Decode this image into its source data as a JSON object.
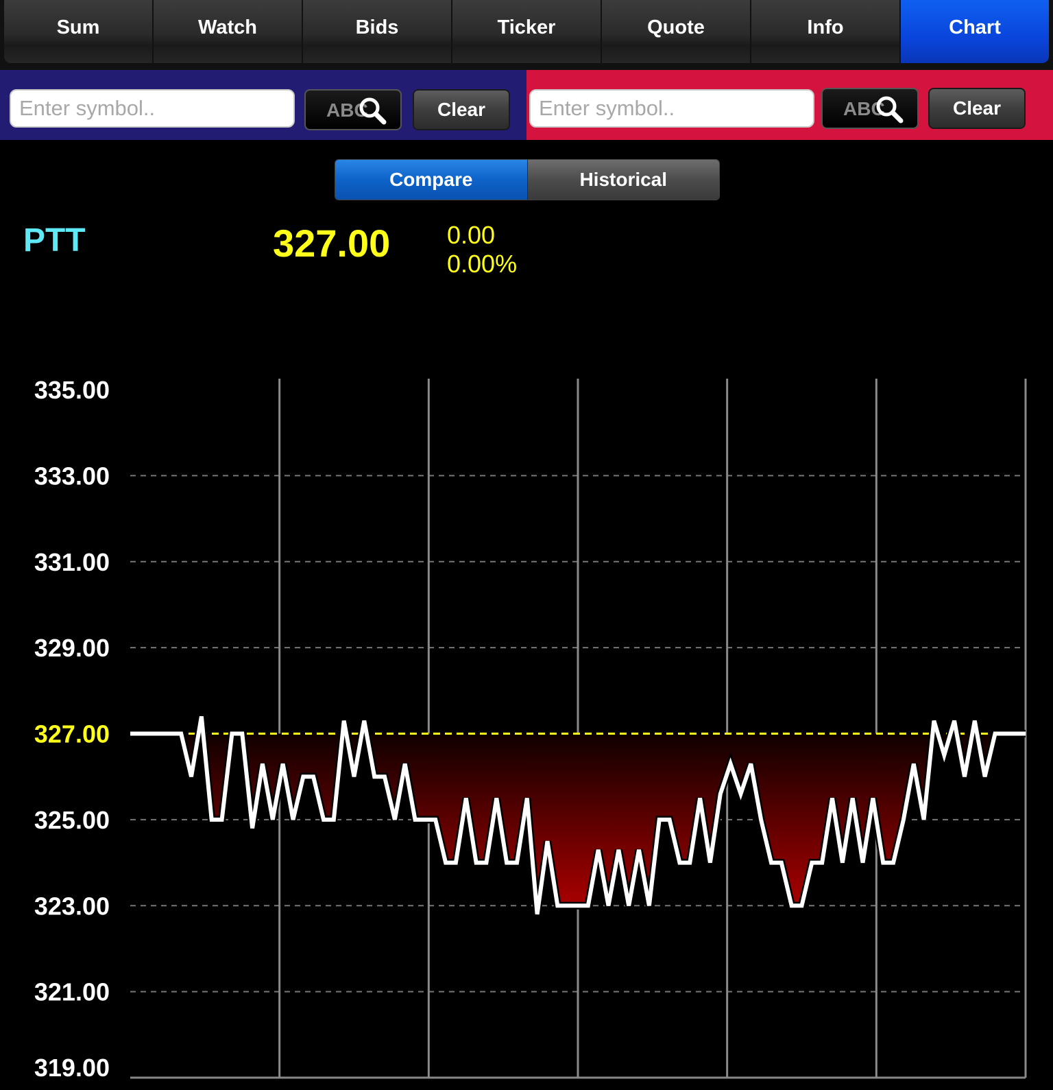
{
  "tabs": [
    "Sum",
    "Watch",
    "Bids",
    "Ticker",
    "Quote",
    "Info",
    "Chart"
  ],
  "active_tab": "Chart",
  "left_bar": {
    "placeholder": "Enter symbol..",
    "abc_label": "ABC",
    "clear_label": "Clear"
  },
  "right_bar": {
    "placeholder": "Enter symbol..",
    "abc_label": "ABC",
    "clear_label": "Clear"
  },
  "segment": {
    "compare": "Compare",
    "historical": "Historical",
    "selected": "Compare"
  },
  "quote": {
    "symbol": "PTT",
    "last": "327.00",
    "change": "0.00",
    "change_pct": "0.00%"
  },
  "colors": {
    "symbol": "#5fe8f5",
    "price": "#ffff1a",
    "left_bar": "#221d73",
    "right_bar": "#d4143e",
    "active_tab": "#0a45db",
    "line": "#ffffff",
    "fill": "#a50000",
    "reference": "#ffff1a"
  },
  "chart_data": {
    "type": "line",
    "title": "",
    "xlabel": "",
    "ylabel": "",
    "ylim": [
      319,
      335
    ],
    "yticks": [
      "335.00",
      "333.00",
      "331.00",
      "329.00",
      "327.00",
      "325.00",
      "323.00",
      "321.00",
      "319.00"
    ],
    "reference_value": 327.0,
    "grid": "horizontal dashed, vertical solid",
    "x_divisions": 6,
    "series": [
      {
        "values": [
          327,
          327,
          327,
          327,
          327,
          327,
          326,
          327.4,
          325,
          325,
          327,
          327,
          324.8,
          326.3,
          325,
          326.3,
          325,
          326,
          326,
          325,
          325,
          327.3,
          326,
          327.3,
          326,
          326,
          325,
          326.3,
          325,
          325,
          325,
          324,
          324,
          325.5,
          324,
          324,
          325.5,
          324,
          324,
          325.5,
          322.8,
          324.5,
          323,
          323,
          323,
          323,
          324.3,
          323,
          324.3,
          323,
          324.3,
          323,
          325,
          325,
          324,
          324,
          325.5,
          324,
          325.6,
          326.3,
          325.6,
          326.3,
          325,
          324,
          324,
          323,
          323,
          324,
          324,
          325.5,
          324,
          325.5,
          324,
          325.5,
          324,
          324,
          325,
          326.3,
          325,
          327.3,
          326.5,
          327.3,
          326,
          327.3,
          326,
          327,
          327,
          327,
          327
        ]
      }
    ]
  }
}
